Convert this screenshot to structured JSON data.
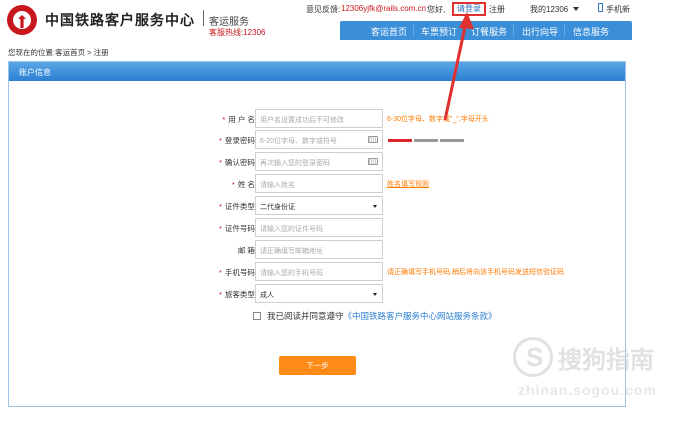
{
  "header": {
    "brand_title": "中国铁路客户服务中心",
    "brand_sub": "客运服务",
    "hotline": "客服热线:12306",
    "feedback_label": "意见反馈:",
    "feedback_email": "12306yjfk@rails.com.cn",
    "greeting": "您好,",
    "login": "请登录",
    "register": "注册",
    "my_account": "我的12306",
    "mobile": "手机新"
  },
  "nav": {
    "items": [
      "客运首页",
      "车票预订",
      "订餐服务",
      "出行向导",
      "信息服务"
    ]
  },
  "breadcrumb": "您现在的位置:客运首页 > 注册",
  "panel": {
    "title": "账户信息"
  },
  "form": {
    "username": {
      "label": "用 户 名:",
      "placeholder": "用户名设置成功后不可修改",
      "hint": "6-30位字母、数字或\"_\",字母开头"
    },
    "password": {
      "label": "登录密码:",
      "placeholder": "6-20位字母、数字或符号"
    },
    "confirm_password": {
      "label": "确认密码:",
      "placeholder": "再次输入您的登录密码"
    },
    "name": {
      "label": "姓 名:",
      "placeholder": "请输入姓名",
      "hint": "姓名填写规则"
    },
    "id_type": {
      "label": "证件类型:",
      "value": "二代身份证"
    },
    "id_number": {
      "label": "证件号码:",
      "placeholder": "请输入您的证件号码"
    },
    "email": {
      "label": "邮 箱:",
      "placeholder": "请正确填写邮箱地址"
    },
    "phone": {
      "label": "手机号码:",
      "placeholder": "请输入您的手机号码",
      "hint": "请正确填写手机号码,稍后将向该手机号码发送短信验证码"
    },
    "passenger_type": {
      "label": "旅客类型:",
      "value": "成人"
    },
    "required_mark": "*",
    "agree_text": "我已阅读并同意遵守",
    "agree_link": "《中国铁路客户服务中心网站服务条款》",
    "next_button": "下一步"
  },
  "password_strength_colors": [
    "#d9242a",
    "#999999",
    "#999999"
  ],
  "watermark": {
    "text": "搜狗指南",
    "url": "zhinan.sogou.com"
  },
  "colors": {
    "brand_red": "#c8161d",
    "nav_blue": "#3b8fd9",
    "hint_orange": "#ff7a00",
    "button_orange": "#ff8a16",
    "annotation_red": "#e03030"
  }
}
